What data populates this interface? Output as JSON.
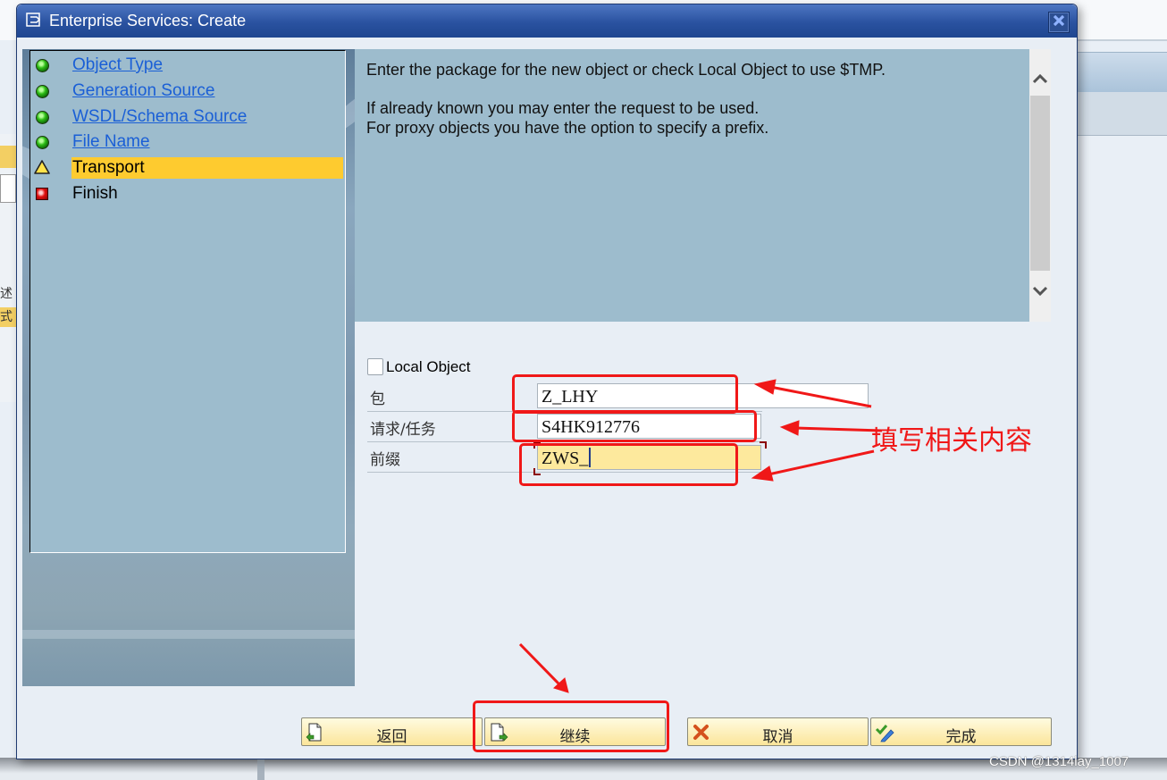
{
  "dialog": {
    "title": "Enterprise Services: Create",
    "close_icon": "close-icon"
  },
  "steps": [
    {
      "label": "Object Type",
      "status": "complete",
      "icon": "green-light-icon",
      "link": true
    },
    {
      "label": "Generation Source",
      "status": "complete",
      "icon": "green-light-icon",
      "link": true
    },
    {
      "label": "WSDL/Schema Source",
      "status": "complete",
      "icon": "green-light-icon",
      "link": true
    },
    {
      "label": "File Name",
      "status": "complete",
      "icon": "green-light-icon",
      "link": true
    },
    {
      "label": "Transport",
      "status": "current",
      "icon": "warning-triangle-icon",
      "link": false
    },
    {
      "label": "Finish",
      "status": "pending",
      "icon": "red-square-icon",
      "link": false
    }
  ],
  "info": {
    "line1": "Enter the package for the new object or check Local Object to use $TMP.",
    "line2": "If already known you may enter the request to be used.",
    "line3": "For proxy objects you have the option to specify a prefix."
  },
  "form": {
    "local_object": {
      "label": "Local Object",
      "checked": false
    },
    "package": {
      "label": "包",
      "value": "Z_LHY"
    },
    "request": {
      "label": "请求/任务",
      "value": "S4HK912776"
    },
    "prefix": {
      "label": "前缀",
      "value": "ZWS_"
    }
  },
  "annotation": {
    "text": "填写相关内容",
    "color": "#f01818"
  },
  "buttons": {
    "back": {
      "label": "返回",
      "icon": "back-doc-icon"
    },
    "continue": {
      "label": "继续",
      "icon": "continue-doc-icon"
    },
    "cancel": {
      "label": "取消",
      "icon": "cancel-x-icon"
    },
    "complete": {
      "label": "完成",
      "icon": "complete-check-icon"
    }
  },
  "background": {
    "left_text_1": "述",
    "left_text_2": "式"
  },
  "watermark": "CSDN @1314lay_1007"
}
